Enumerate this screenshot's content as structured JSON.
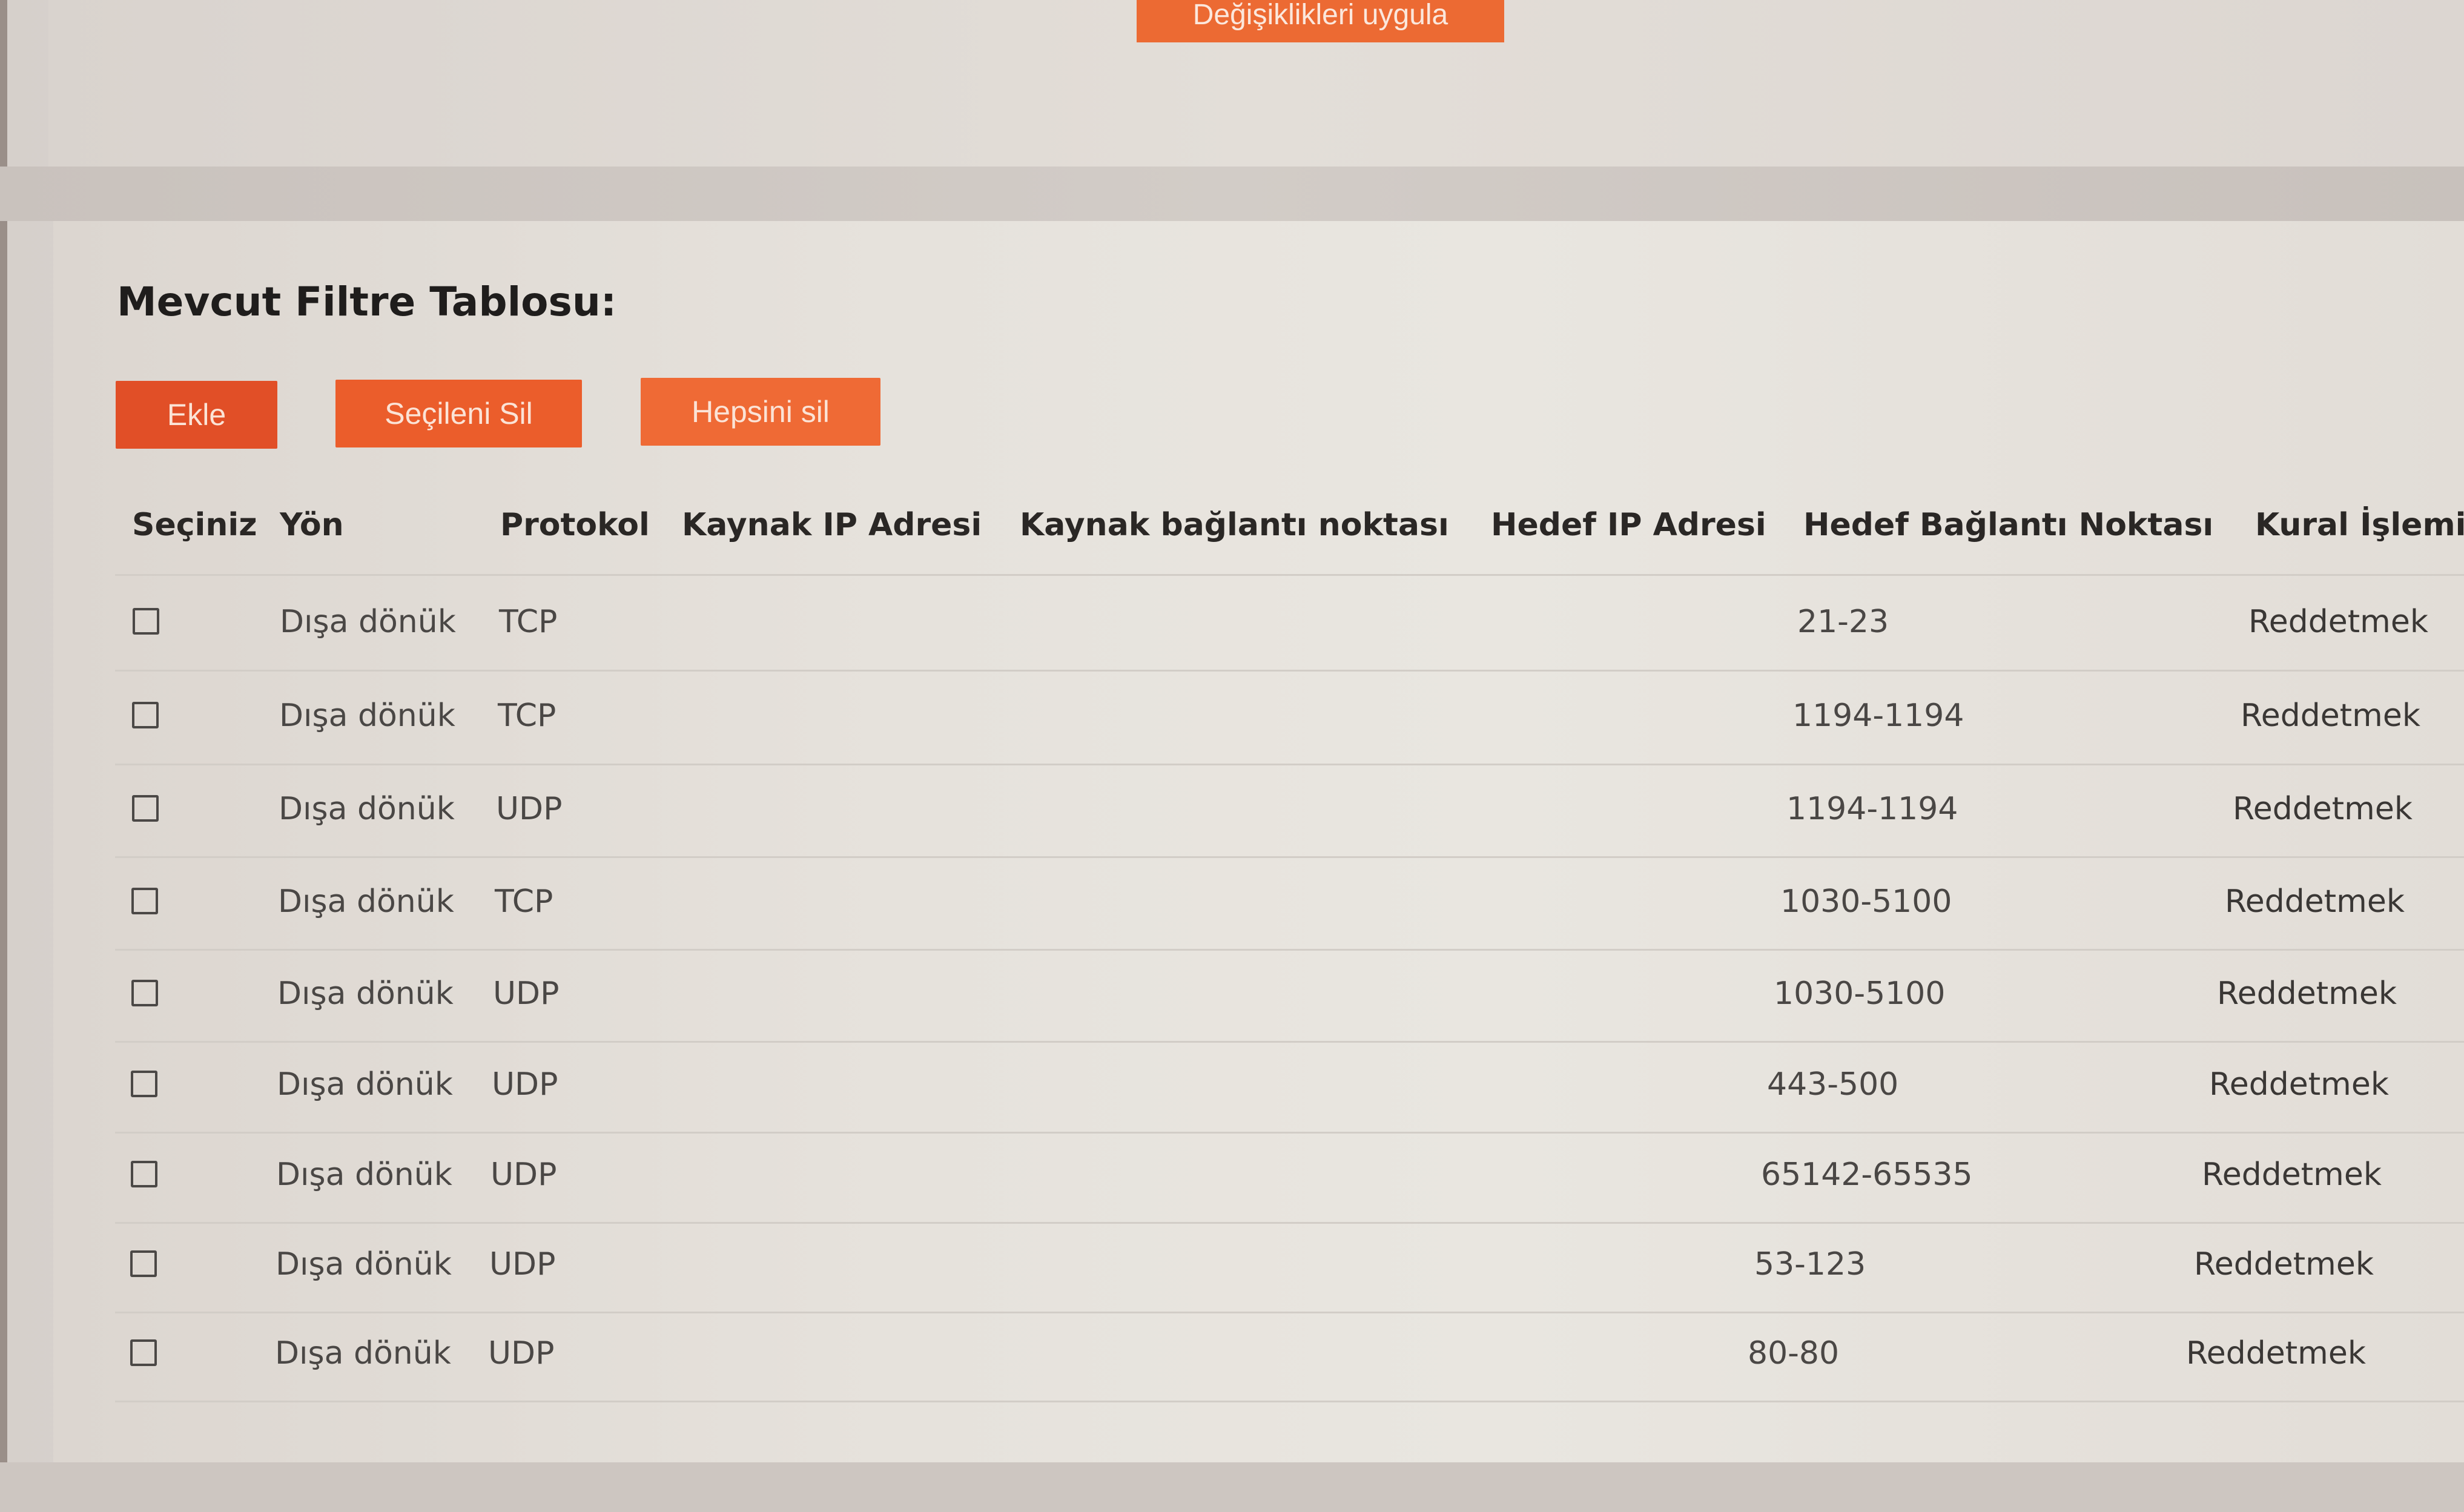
{
  "top": {
    "apply_label": "Değişiklikleri uygula"
  },
  "section": {
    "title": "Mevcut Filtre Tablosu:"
  },
  "toolbar": {
    "add_label": "Ekle",
    "delete_selected_label": "Seçileni Sil",
    "delete_all_label": "Hepsini sil"
  },
  "colors": {
    "accent": "#e8582a",
    "button_text": "#fbe3d6"
  },
  "table": {
    "headers": [
      "Seçiniz",
      "Yön",
      "Protokol",
      "Kaynak IP Adresi",
      "Kaynak bağlantı noktası",
      "Hedef IP Adresi",
      "Hedef Bağlantı Noktası",
      "Kural İşlemi"
    ],
    "rows": [
      {
        "selected": false,
        "direction": "Dışa dönük",
        "protocol": "TCP",
        "src_ip": "",
        "src_port": "",
        "dst_ip": "",
        "dst_port": "21-23",
        "action": "Reddetmek"
      },
      {
        "selected": false,
        "direction": "Dışa dönük",
        "protocol": "TCP",
        "src_ip": "",
        "src_port": "",
        "dst_ip": "",
        "dst_port": "1194-1194",
        "action": "Reddetmek"
      },
      {
        "selected": false,
        "direction": "Dışa dönük",
        "protocol": "UDP",
        "src_ip": "",
        "src_port": "",
        "dst_ip": "",
        "dst_port": "1194-1194",
        "action": "Reddetmek"
      },
      {
        "selected": false,
        "direction": "Dışa dönük",
        "protocol": "TCP",
        "src_ip": "",
        "src_port": "",
        "dst_ip": "",
        "dst_port": "1030-5100",
        "action": "Reddetmek"
      },
      {
        "selected": false,
        "direction": "Dışa dönük",
        "protocol": "UDP",
        "src_ip": "",
        "src_port": "",
        "dst_ip": "",
        "dst_port": "1030-5100",
        "action": "Reddetmek"
      },
      {
        "selected": false,
        "direction": "Dışa dönük",
        "protocol": "UDP",
        "src_ip": "",
        "src_port": "",
        "dst_ip": "",
        "dst_port": "443-500",
        "action": "Reddetmek"
      },
      {
        "selected": false,
        "direction": "Dışa dönük",
        "protocol": "UDP",
        "src_ip": "",
        "src_port": "",
        "dst_ip": "",
        "dst_port": "65142-65535",
        "action": "Reddetmek"
      },
      {
        "selected": false,
        "direction": "Dışa dönük",
        "protocol": "UDP",
        "src_ip": "",
        "src_port": "",
        "dst_ip": "",
        "dst_port": "53-123",
        "action": "Reddetmek"
      },
      {
        "selected": false,
        "direction": "Dışa dönük",
        "protocol": "UDP",
        "src_ip": "",
        "src_port": "",
        "dst_ip": "",
        "dst_port": "80-80",
        "action": "Reddetmek"
      }
    ]
  }
}
